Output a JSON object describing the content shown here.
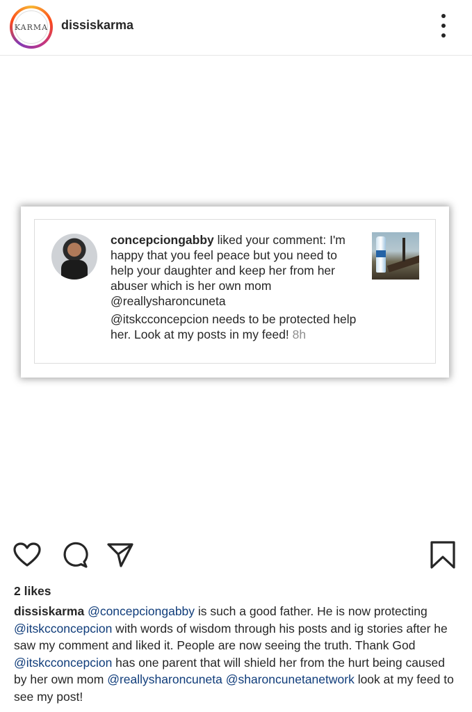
{
  "header": {
    "avatar_text": "KARMA",
    "username": "dissiskarma"
  },
  "notification": {
    "username": "concepciongabby",
    "action": " liked your comment: ",
    "comment_line1": "I'm happy that you feel peace but you need to help your daughter and keep her from her abuser which is her own mom ",
    "mention1": "@reallysharoncuneta",
    "mention2": "@itskcconcepcion",
    "comment_line2": " needs to be protected help her. Look at my posts in my feed! ",
    "time": "8h"
  },
  "post": {
    "likes": "2 likes",
    "caption_user": "dissiskarma",
    "caption_parts": {
      "m1": "@concepciongabby",
      "t1": " is such a good father. He is now protecting ",
      "m2": "@itskcconcepcion",
      "t2": " with words of wisdom through his posts and ig stories after he saw my comment and liked it. People are now seeing the truth. Thank God ",
      "m3": "@itskcconcepcion",
      "t3": " has one parent that will shield her from the hurt being caused by her own mom ",
      "m4": "@reallysharoncuneta",
      "t4": " ",
      "m5": "@sharoncunetanetwork",
      "t5": " look at my feed to see my post!"
    }
  },
  "icons": {
    "like": "heart-icon",
    "comment": "comment-icon",
    "share": "share-icon",
    "save": "bookmark-icon",
    "more": "more-icon"
  }
}
